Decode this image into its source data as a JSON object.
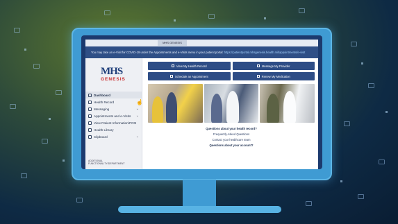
{
  "window": {
    "top_tab": "MHS GENESIS",
    "banner_text": "You may take an e-Visit for COVID-19 under the Appointments and e-Visits menu in your patient portal:",
    "banner_link": "https://patientportal.mhsgenesis.health.mil/appointments/e-visit"
  },
  "logo": {
    "mhs": "MHS",
    "genesis": "GENESIS"
  },
  "sidebar": {
    "items": [
      {
        "label": "Dashboard",
        "chevron": ""
      },
      {
        "label": "Health Record",
        "chevron": "⌄"
      },
      {
        "label": "Messaging",
        "chevron": "⌄"
      },
      {
        "label": "Appointments and e-Visits",
        "chevron": "⌄"
      },
      {
        "label": "View Patient Information/PCM",
        "chevron": ""
      },
      {
        "label": "Health Library",
        "chevron": ""
      },
      {
        "label": "Clipboard",
        "chevron": "⌄"
      }
    ],
    "bottom_text": "ADDITIONAL FUNCTIONALITY/DEPARTMENT"
  },
  "actions": {
    "view_health_record": "View My Health Record",
    "message_provider": "Message My Provider",
    "schedule_appointment": "Schedule an Appointment",
    "renew_medication": "Renew My Medication"
  },
  "faq": {
    "question_1": "Questions about your health record?",
    "link_1": "Frequently Asked Questions",
    "link_2": "Contact your healthcare team",
    "question_2": "Questions about your account?"
  }
}
